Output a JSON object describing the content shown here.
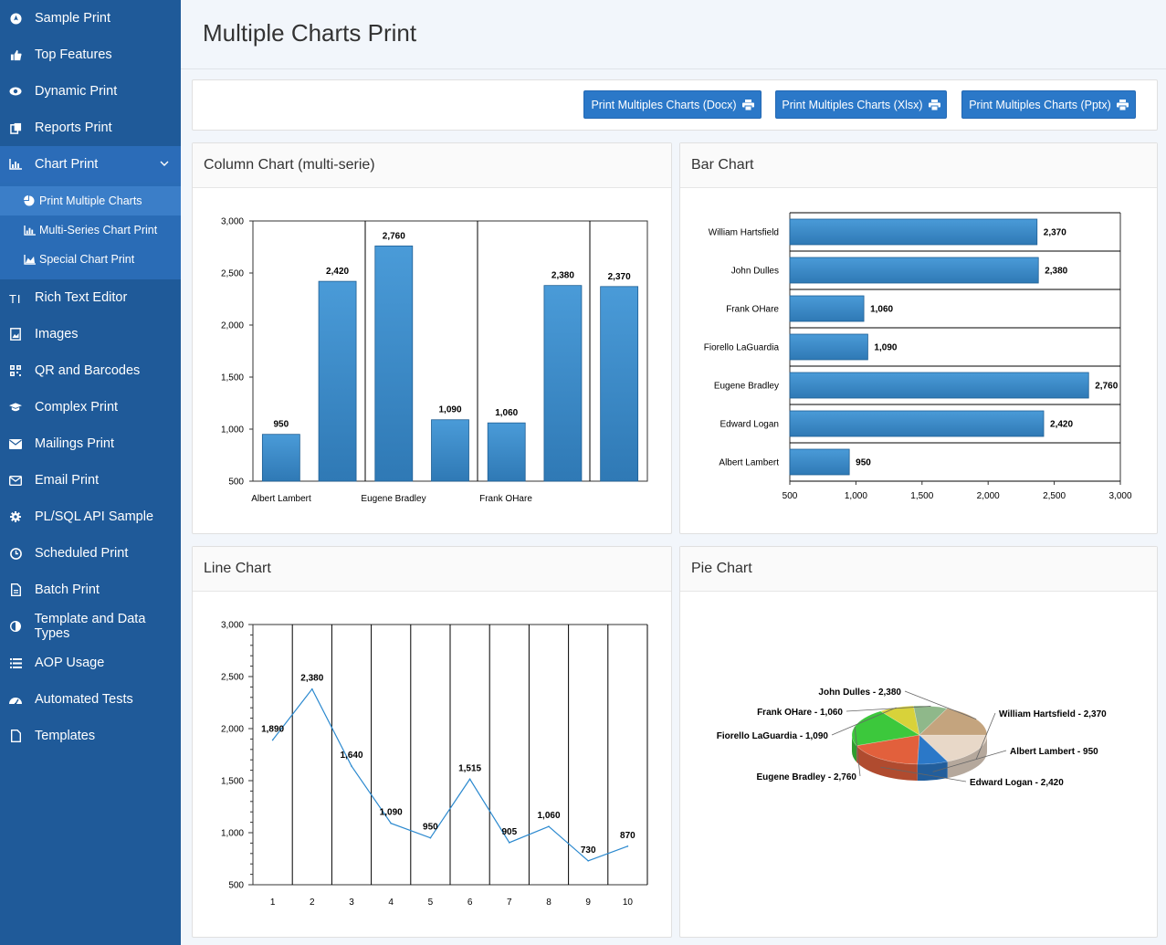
{
  "sidebar": {
    "items": [
      {
        "label": "Sample Print",
        "icon": "rocket-icon"
      },
      {
        "label": "Top Features",
        "icon": "thumbs-up-icon"
      },
      {
        "label": "Dynamic Print",
        "icon": "eye-icon"
      },
      {
        "label": "Reports Print",
        "icon": "copy-icon"
      },
      {
        "label": "Chart Print",
        "icon": "bar-chart-icon"
      },
      {
        "label": "Rich Text Editor",
        "icon": "text-icon"
      },
      {
        "label": "Images",
        "icon": "image-icon"
      },
      {
        "label": "QR and Barcodes",
        "icon": "qrcode-icon"
      },
      {
        "label": "Complex Print",
        "icon": "graduation-cap-icon"
      },
      {
        "label": "Mailings Print",
        "icon": "envelope-icon"
      },
      {
        "label": "Email Print",
        "icon": "envelope-outline-icon"
      },
      {
        "label": "PL/SQL API Sample",
        "icon": "gear-icon"
      },
      {
        "label": "Scheduled Print",
        "icon": "clock-icon"
      },
      {
        "label": "Batch Print",
        "icon": "file-icon"
      },
      {
        "label": "Template and Data Types",
        "icon": "adjust-icon"
      },
      {
        "label": "AOP Usage",
        "icon": "list-icon"
      },
      {
        "label": "Automated Tests",
        "icon": "dashboard-icon"
      },
      {
        "label": "Templates",
        "icon": "file-outline-icon"
      }
    ],
    "sub_items": [
      {
        "label": "Print Multiple Charts",
        "icon": "pie-chart-icon"
      },
      {
        "label": "Multi-Series Chart Print",
        "icon": "bar-chart-icon"
      },
      {
        "label": "Special Chart Print",
        "icon": "area-chart-icon"
      }
    ]
  },
  "header": {
    "title": "Multiple Charts Print"
  },
  "toolbar": {
    "docx_label": "Print Multiples Charts (Docx)",
    "xlsx_label": "Print Multiples Charts (Xlsx)",
    "pptx_label": "Print Multiples Charts (Pptx)"
  },
  "colors": {
    "sidebar_bg": "#1f5a99",
    "accent": "#2b78c8",
    "bar": "#3a8bcb"
  },
  "chart_data": [
    {
      "card_title": "Column Chart (multi-serie)",
      "type": "bar",
      "values": [
        950,
        2420,
        2760,
        1090,
        1060,
        2380,
        2370
      ],
      "labels": [
        "950",
        "2,420",
        "2,760",
        "1,090",
        "1,060",
        "2,380",
        "2,370"
      ],
      "category_labels": [
        "Albert Lambert",
        "Eugene Bradley",
        "Frank OHare"
      ],
      "ylim": [
        500,
        3000
      ],
      "yticks": [
        "500",
        "1,000",
        "1,500",
        "2,000",
        "2,500",
        "3,000"
      ]
    },
    {
      "card_title": "Bar Chart",
      "type": "bar",
      "orientation": "horizontal",
      "categories": [
        "William Hartsfield",
        "John Dulles",
        "Frank OHare",
        "Fiorello LaGuardia",
        "Eugene Bradley",
        "Edward Logan",
        "Albert Lambert"
      ],
      "values": [
        2370,
        2380,
        1060,
        1090,
        2760,
        2420,
        950
      ],
      "labels": [
        "2,370",
        "2,380",
        "1,060",
        "1,090",
        "2,760",
        "2,420",
        "950"
      ],
      "xlim": [
        500,
        3000
      ],
      "xticks": [
        "500",
        "1,000",
        "1,500",
        "2,000",
        "2,500",
        "3,000"
      ]
    },
    {
      "card_title": "Line Chart",
      "type": "line",
      "x": [
        "1",
        "2",
        "3",
        "4",
        "5",
        "6",
        "7",
        "8",
        "9",
        "10"
      ],
      "values": [
        1890,
        2380,
        1640,
        1090,
        950,
        1515,
        905,
        1060,
        730,
        870
      ],
      "labels": [
        "1,890",
        "2,380",
        "1,640",
        "1,090",
        "950",
        "1,515",
        "905",
        "1,060",
        "730",
        "870"
      ],
      "ylim": [
        500,
        3000
      ],
      "yticks": [
        "500",
        "1,000",
        "1,500",
        "2,000",
        "2,500",
        "3,000"
      ]
    },
    {
      "card_title": "Pie Chart",
      "type": "pie",
      "slices": [
        {
          "name": "William Hartsfield",
          "value": 2370,
          "color": "#e8d8c8"
        },
        {
          "name": "Albert Lambert",
          "value": 950,
          "color": "#2b78c8"
        },
        {
          "name": "Edward Logan",
          "value": 2420,
          "color": "#e2603c"
        },
        {
          "name": "Eugene Bradley",
          "value": 2760,
          "color": "#3cc83c"
        },
        {
          "name": "Fiorello LaGuardia",
          "value": 1090,
          "color": "#d8d23a"
        },
        {
          "name": "Frank OHare",
          "value": 1060,
          "color": "#8fb88a"
        },
        {
          "name": "John Dulles",
          "value": 2380,
          "color": "#c4a47e"
        }
      ],
      "labels": [
        "William Hartsfield - 2,370",
        "Albert Lambert - 950",
        "Edward Logan - 2,420",
        "Eugene Bradley - 2,760",
        "Fiorello LaGuardia - 1,090",
        "Frank OHare - 1,060",
        "John Dulles - 2,380"
      ]
    }
  ]
}
